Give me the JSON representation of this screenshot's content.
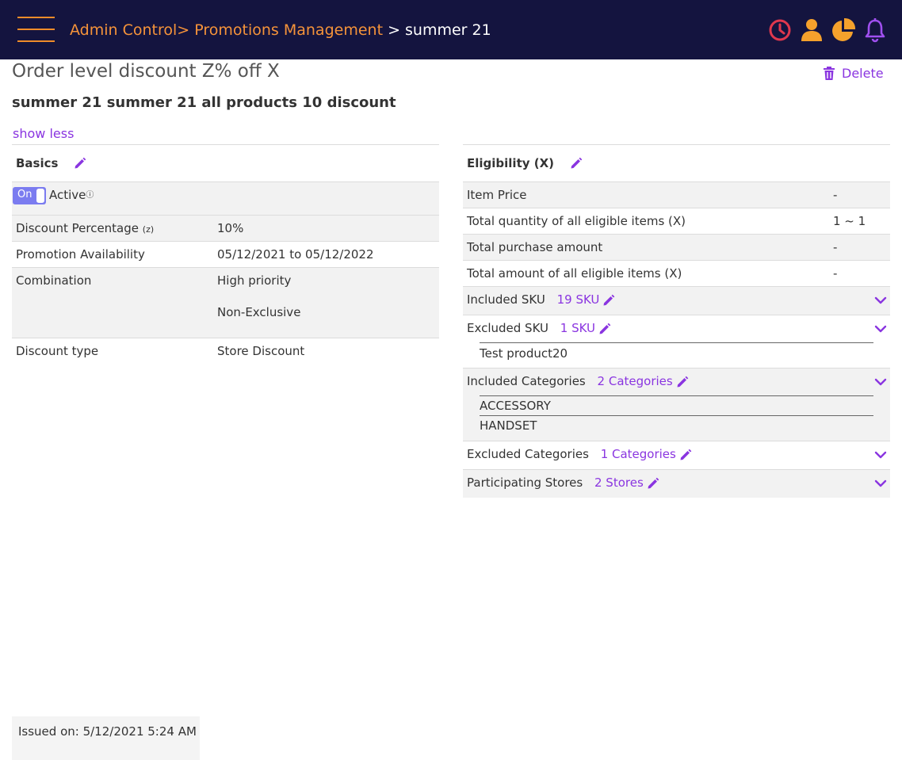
{
  "header": {
    "crumb_admin": "Admin Control",
    "sep1": ">",
    "crumb_promotions": "Promotions Management",
    "sep2": " > ",
    "crumb_current": "summer 21",
    "icons": [
      "clock-icon",
      "user-icon",
      "pie-chart-icon",
      "bell-icon"
    ],
    "colors": {
      "bg": "#14143f",
      "link": "#f5933a",
      "clock": "#e0384e",
      "user": "#f5a12c",
      "chart": "#f5a12c",
      "bell": "#a050f0"
    }
  },
  "page": {
    "title": "Order level discount Z% off X",
    "subtitle": "summer 21 summer 21 all products 10 discount",
    "show_less": "show less",
    "delete_label": "Delete",
    "accent": "#8a35e0"
  },
  "basics": {
    "title": "Basics",
    "toggle_label": "On",
    "active_label": "Active",
    "help_glyph": "?",
    "discount_percentage_label": "Discount Percentage",
    "discount_percentage_suffix": "(z)",
    "discount_percentage_value": "10%",
    "availability_label": "Promotion Availability",
    "availability_value": "05/12/2021 to 05/12/2022",
    "combination_label": "Combination",
    "combination_values": [
      "High priority",
      "Non-Exclusive"
    ],
    "discount_type_label": "Discount type",
    "discount_type_value": "Store Discount"
  },
  "eligibility": {
    "title": "Eligibility (X)",
    "rows": [
      {
        "label": "Item Price",
        "value": "-"
      },
      {
        "label": "Total quantity of all eligible items (X)",
        "value": "1 ~ 1"
      },
      {
        "label": "Total purchase amount",
        "value": "-"
      },
      {
        "label": "Total amount of all eligible items (X)",
        "value": "-"
      }
    ],
    "included_sku": {
      "label": "Included SKU",
      "count": "19 SKU"
    },
    "excluded_sku": {
      "label": "Excluded SKU",
      "count": "1 SKU",
      "items": [
        "Test product20"
      ]
    },
    "included_categories": {
      "label": "Included Categories",
      "count": "2 Categories",
      "items": [
        "ACCESSORY",
        "HANDSET"
      ]
    },
    "excluded_categories": {
      "label": "Excluded Categories",
      "count": "1 Categories"
    },
    "participating_stores": {
      "label": "Participating Stores",
      "count": "2 Stores"
    }
  },
  "footer": {
    "issued": "Issued on: 5/12/2021 5:24 AM"
  }
}
